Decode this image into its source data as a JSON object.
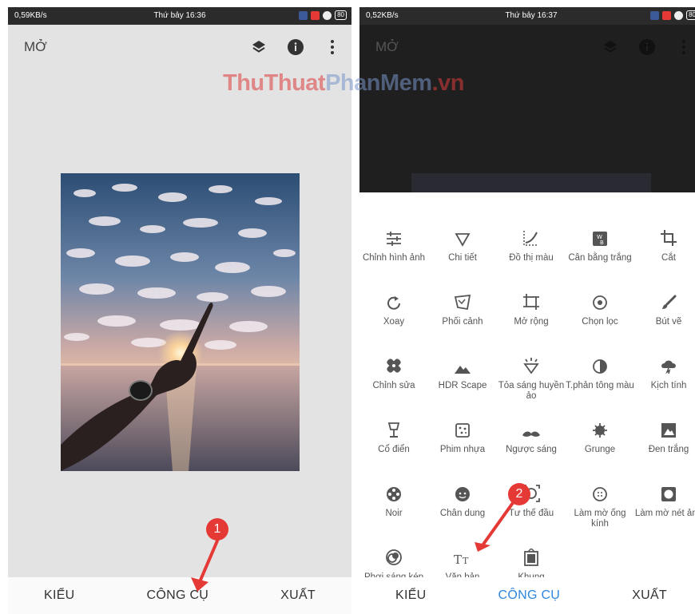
{
  "watermark": {
    "part1": "ThuThuat",
    "part2": "PhanMem",
    "part3": ".vn"
  },
  "left_screen": {
    "status": {
      "speed": "0,59KB/s",
      "time": "Thứ bảy 16:36",
      "battery": "80"
    },
    "appbar": {
      "open_label": "MỞ"
    },
    "bottom_nav": [
      {
        "label": "KIỂU"
      },
      {
        "label": "CÔNG CỤ"
      },
      {
        "label": "XUẤT"
      }
    ],
    "badge": "1"
  },
  "right_screen": {
    "status": {
      "speed": "0,52KB/s",
      "time": "Thứ bảy 16:37",
      "battery": "80"
    },
    "appbar": {
      "open_label": "MỞ"
    },
    "tools": [
      {
        "label": "Chỉnh hình ảnh",
        "icon": "tune-icon"
      },
      {
        "label": "Chi tiết",
        "icon": "triangle-icon"
      },
      {
        "label": "Đồ thị màu",
        "icon": "curves-icon"
      },
      {
        "label": "Cân bằng trắng",
        "icon": "white-balance-icon"
      },
      {
        "label": "Cắt",
        "icon": "crop-icon"
      },
      {
        "label": "Xoay",
        "icon": "rotate-icon"
      },
      {
        "label": "Phối cảnh",
        "icon": "perspective-icon"
      },
      {
        "label": "Mở rộng",
        "icon": "expand-icon"
      },
      {
        "label": "Chọn lọc",
        "icon": "selective-icon"
      },
      {
        "label": "Bút vẽ",
        "icon": "brush-icon"
      },
      {
        "label": "Chỉnh sửa",
        "icon": "healing-icon"
      },
      {
        "label": "HDR Scape",
        "icon": "mountain-icon"
      },
      {
        "label": "Tỏa sáng huyền ảo",
        "icon": "glamour-icon"
      },
      {
        "label": "T.phản tông màu",
        "icon": "tonal-contrast-icon"
      },
      {
        "label": "Kịch tính",
        "icon": "drama-icon"
      },
      {
        "label": "Cổ điển",
        "icon": "lamp-icon"
      },
      {
        "label": "Phim nhựa",
        "icon": "film-icon"
      },
      {
        "label": "Ngược sáng",
        "icon": "mustache-icon"
      },
      {
        "label": "Grunge",
        "icon": "grunge-icon"
      },
      {
        "label": "Đen trắng",
        "icon": "black-white-icon"
      },
      {
        "label": "Noir",
        "icon": "reel-icon"
      },
      {
        "label": "Chân dung",
        "icon": "face-icon"
      },
      {
        "label": "Tư thế đầu",
        "icon": "head-pose-icon"
      },
      {
        "label": "Làm mờ ống kính",
        "icon": "lens-blur-icon"
      },
      {
        "label": "Làm mờ nét ảnh",
        "icon": "vignette-icon"
      },
      {
        "label": "Phơi sáng kép",
        "icon": "double-exposure-icon"
      },
      {
        "label": "Văn bản",
        "icon": "text-icon"
      },
      {
        "label": "Khung",
        "icon": "frame-icon"
      }
    ],
    "bottom_nav": [
      {
        "label": "KIỂU"
      },
      {
        "label": "CÔNG CỤ"
      },
      {
        "label": "XUẤT"
      }
    ],
    "active_nav": "CÔNG CỤ",
    "badge": "2"
  },
  "colors": {
    "accent": "#2e86e0",
    "badge": "#e53935",
    "arrow": "#e53935"
  }
}
